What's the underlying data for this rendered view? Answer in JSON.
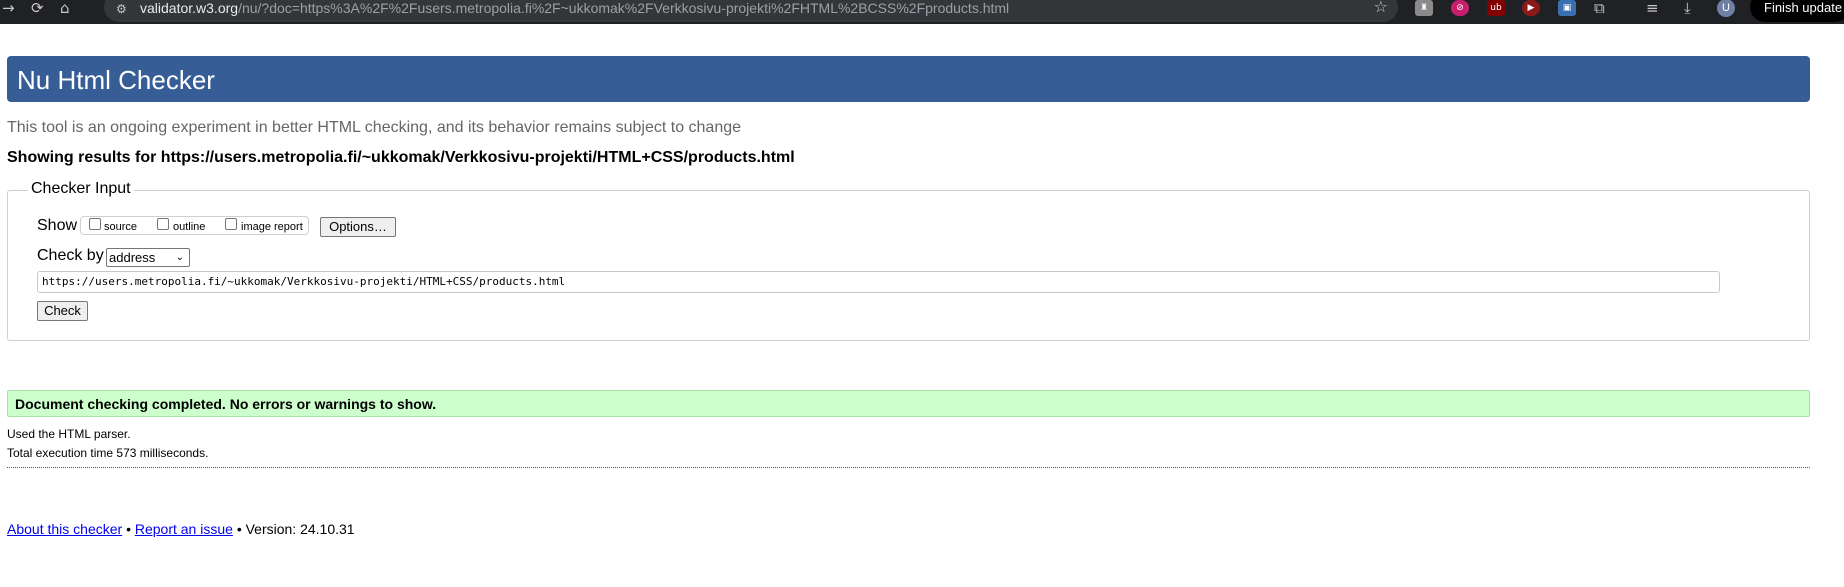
{
  "browser": {
    "url_host": "validator.w3.org",
    "url_rest": "/nu/?doc=https%3A%2F%2Fusers.metropolia.fi%2F~ukkomak%2FVerkkosivu-projekti%2FHTML%2BCSS%2Fproducts.html",
    "avatar_letter": "U",
    "finish_update_label": "Finish update",
    "icons": [
      "back-icon",
      "reload-icon",
      "home-icon",
      "site-info-icon",
      "bookmark-star-icon",
      "extensions-icon",
      "reading-list-icon",
      "download-icon"
    ]
  },
  "header": {
    "title": "Nu Html Checker"
  },
  "intro": {
    "subtitle": "This tool is an ongoing experiment in better HTML checking, and its behavior remains subject to change",
    "results_for": "Showing results for https://users.metropolia.fi/~ukkomak/Verkkosivu-projekti/HTML+CSS/products.html"
  },
  "checker_input": {
    "legend": "Checker Input",
    "show_label": "Show",
    "show_options": [
      {
        "label": "source",
        "checked": false
      },
      {
        "label": "outline",
        "checked": false
      },
      {
        "label": "image report",
        "checked": false
      }
    ],
    "options_button": "Options…",
    "check_by_label": "Check by",
    "check_by_value": "address",
    "url_value": "https://users.metropolia.fi/~ukkomak/Verkkosivu-projekti/HTML+CSS/products.html",
    "check_button": "Check"
  },
  "result": {
    "message": "Document checking completed. No errors or warnings to show.",
    "parser": "Used the HTML parser.",
    "execution_time": "Total execution time 573 milliseconds."
  },
  "footer": {
    "about_link": "About this checker",
    "separator": "•",
    "report_link": "Report an issue",
    "version": "Version: 24.10.31"
  },
  "colors": {
    "header_bg": "#365d95",
    "success_bg": "#ccffcc",
    "link": "#0000ee"
  }
}
